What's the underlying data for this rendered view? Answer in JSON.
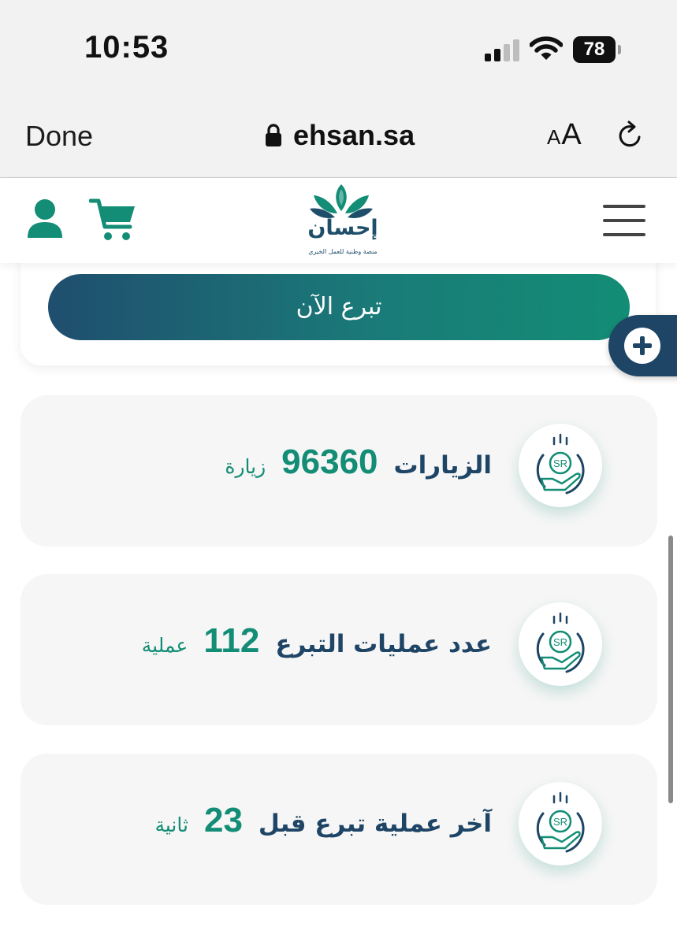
{
  "status_bar": {
    "time": "10:53",
    "battery": "78",
    "icons": [
      "cellular-signal-icon",
      "wifi-icon",
      "battery-icon"
    ]
  },
  "browser": {
    "done_label": "Done",
    "url": "ehsan.sa",
    "text_size_small": "A",
    "text_size_large": "A",
    "icons": [
      "lock-icon",
      "reload-icon"
    ]
  },
  "site_header": {
    "logo_word": "إحسان",
    "logo_tagline": "منصة وطنية للعمل الخيري",
    "icons": [
      "user-icon",
      "cart-icon",
      "hamburger-menu-icon"
    ],
    "colors": {
      "brand_navy": "#1f4566",
      "brand_green": "#138d75"
    }
  },
  "donate": {
    "button_label": "تبرع الآن",
    "fab_icon": "plus-icon"
  },
  "stats": [
    {
      "label": "الزيارات",
      "value": "96360",
      "unit": "زيارة",
      "icon": "hand-coin-sr-icon",
      "icon_text": "SR"
    },
    {
      "label": "عدد عمليات التبرع",
      "value": "112",
      "unit": "عملية",
      "icon": "hand-coin-sr-icon",
      "icon_text": "SR"
    },
    {
      "label": "آخر عملية تبرع قبل",
      "value": "23",
      "unit": "ثانية",
      "icon": "hand-coin-sr-icon",
      "icon_text": "SR"
    }
  ]
}
